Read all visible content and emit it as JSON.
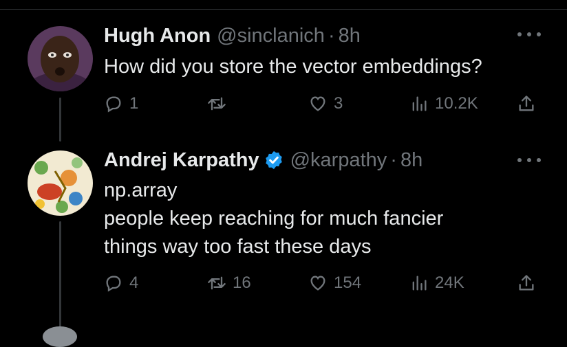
{
  "thread": {
    "replies": [
      {
        "name": "Hugh Anon",
        "handle": "@sinclanich",
        "separator": "·",
        "time": "8h",
        "verified": false,
        "lines": [
          "How did you store the vector embeddings?"
        ],
        "stats": {
          "replies": "1",
          "reposts": "",
          "likes": "3",
          "views": "10.2K"
        }
      },
      {
        "name": "Andrej Karpathy",
        "handle": "@karpathy",
        "separator": "·",
        "time": "8h",
        "verified": true,
        "lines": [
          "np.array",
          "people keep reaching for much fancier",
          "things way too fast these days"
        ],
        "stats": {
          "replies": "4",
          "reposts": "16",
          "likes": "154",
          "views": "24K"
        }
      }
    ]
  },
  "colors": {
    "background": "#000000",
    "text": "#e7e9ea",
    "muted": "#71767b",
    "verified": "#1d9bf0"
  },
  "icons": [
    "reply-icon",
    "repost-icon",
    "like-icon",
    "views-icon",
    "share-icon",
    "more-icon",
    "verified-badge-icon"
  ]
}
